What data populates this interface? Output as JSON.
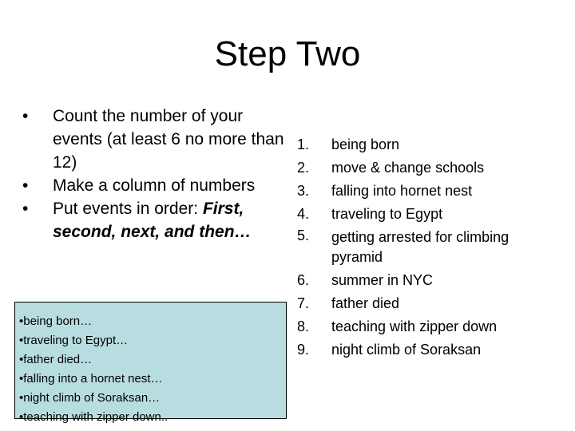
{
  "slide": {
    "title": "Step Two"
  },
  "instructions": {
    "bullet_glyph": "•",
    "items": [
      {
        "text": "Count the number of your events (at least 6 no more than 12)"
      },
      {
        "text": "Make a column of numbers"
      },
      {
        "text_plain": "Put events in order: ",
        "text_emphasis": "First, second, next, and then…"
      }
    ]
  },
  "example_box": {
    "background_color": "#b8dde1",
    "lines": [
      "•being born…",
      "•traveling to Egypt…",
      "•father died…",
      "•falling into a hornet nest…",
      "•night climb of Soraksan…",
      "•teaching with zipper down.."
    ]
  },
  "event_list": {
    "items": [
      {
        "number": "1.",
        "text": "being born"
      },
      {
        "number": "2.",
        "text": "move & change schools"
      },
      {
        "number": "3.",
        "text": "falling into hornet nest"
      },
      {
        "number": "4.",
        "text": "traveling to Egypt"
      },
      {
        "number": "5.",
        "text": "getting arrested for climbing pyramid"
      },
      {
        "number": "6.",
        "text": "summer in NYC"
      },
      {
        "number": "7.",
        "text": "father died"
      },
      {
        "number": "8.",
        "text": "teaching with zipper down"
      },
      {
        "number": "9.",
        "text": "night climb of Soraksan"
      }
    ]
  }
}
